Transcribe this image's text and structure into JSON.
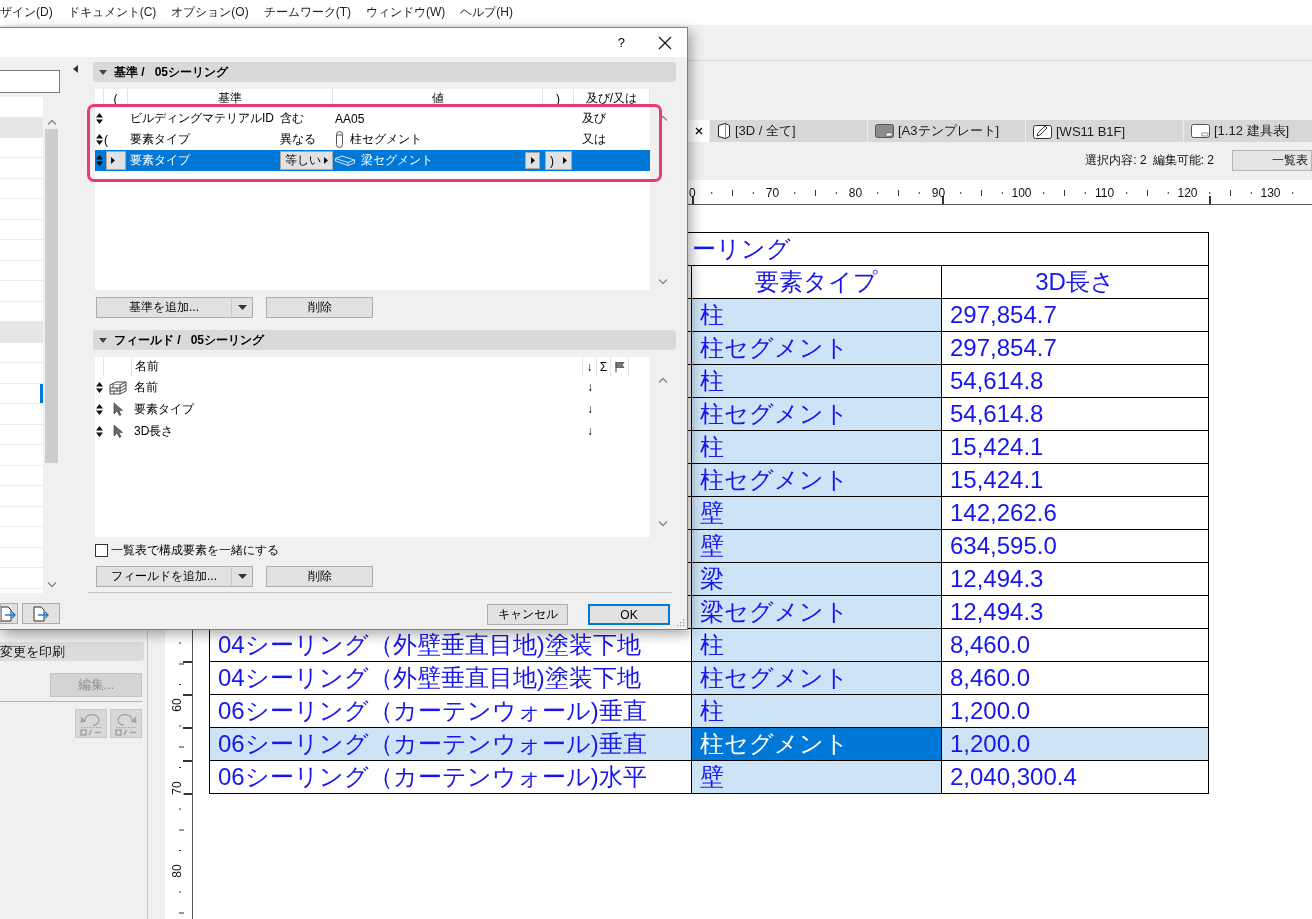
{
  "menu_bar": {
    "items": [
      "ザイン(D)",
      "ドキュメント(C)",
      "オプション(O)",
      "チームワーク(T)",
      "ウィンドウ(W)",
      "ヘルプ(H)"
    ]
  },
  "tab_bar": {
    "tabs": [
      {
        "selected": true
      },
      {
        "kind": "model",
        "label": "[3D / 全て]",
        "selected": false
      },
      {
        "kind": "master",
        "label": "[A3テンプレート]",
        "selected": false
      },
      {
        "kind": "worksheet",
        "label": "[WS11 B1F]",
        "selected": false
      },
      {
        "kind": "layout",
        "label": "[1.12 建具表]",
        "selected": false
      }
    ]
  },
  "info_bar": {
    "selection": "選択内容: 2",
    "editable": "編集可能: 2",
    "schedule_button": "一覧表"
  },
  "left_panel": {
    "section": "変更を印刷",
    "edit_button": {
      "label": "編集...",
      "disabled": true
    },
    "undo": {
      "disabled": true
    },
    "redo": {
      "disabled": true
    }
  },
  "horizontal_ruler": {
    "labels": [
      "0",
      "70",
      "80",
      "90",
      "100",
      "110",
      "120",
      "130"
    ]
  },
  "vertical_ruler": {
    "labels": [
      "60",
      "70",
      "80"
    ]
  },
  "schedule": {
    "title": "ーリング",
    "columns": [
      {
        "highlighted": false
      },
      {
        "label": "要素タイプ",
        "highlighted": true
      },
      {
        "label": "3D長さ",
        "highlighted": false
      }
    ],
    "rows": [
      {
        "type": "柱",
        "length": "297,854.7",
        "selected": false,
        "type_focused": false
      },
      {
        "type": "柱セグメント",
        "length": "297,854.7",
        "selected": false,
        "type_focused": false
      },
      {
        "type": "柱",
        "length": "54,614.8",
        "selected": false,
        "type_focused": false
      },
      {
        "type": "柱セグメント",
        "length": "54,614.8",
        "selected": false,
        "type_focused": false
      },
      {
        "type": "柱",
        "length": "15,424.1",
        "selected": false,
        "type_focused": false
      },
      {
        "type": "柱セグメント",
        "length": "15,424.1",
        "selected": false,
        "type_focused": false
      },
      {
        "type": "壁",
        "length": "142,262.6",
        "selected": false,
        "type_focused": false
      },
      {
        "type": "壁",
        "length": "634,595.0",
        "selected": false,
        "type_focused": false
      },
      {
        "type": "梁",
        "length": "12,494.3",
        "selected": false,
        "type_focused": false
      },
      {
        "type": "梁セグメント",
        "length": "12,494.3",
        "selected": false,
        "type_focused": false
      },
      {
        "name": "04シーリング（外壁垂直目地)塗装下地",
        "type": "柱",
        "length": "8,460.0",
        "selected": false,
        "type_focused": false
      },
      {
        "name": "04シーリング（外壁垂直目地)塗装下地",
        "type": "柱セグメント",
        "length": "8,460.0",
        "selected": false,
        "type_focused": false
      },
      {
        "name": "06シーリング（カーテンウォール)垂直",
        "type": "柱",
        "length": "1,200.0",
        "selected": false,
        "type_focused": false
      },
      {
        "name": "06シーリング（カーテンウォール)垂直",
        "type": "柱セグメント",
        "length": "1,200.0",
        "selected": true,
        "type_focused": true
      },
      {
        "name": "06シーリング（カーテンウォール)水平",
        "type": "壁",
        "length": "2,040,300.4",
        "selected": false,
        "type_focused": false
      }
    ]
  },
  "dialog": {
    "help": "?",
    "scheme_list": {
      "rows": [
        {
          "kind": "group",
          "selected": false
        },
        {
          "kind": "item",
          "selected": false
        },
        {
          "kind": "item",
          "selected": false
        },
        {
          "kind": "item",
          "selected": false
        },
        {
          "kind": "item",
          "selected": false
        },
        {
          "kind": "item",
          "selected": false
        },
        {
          "kind": "item",
          "selected": false
        },
        {
          "kind": "item",
          "selected": false
        },
        {
          "kind": "item",
          "selected": false
        },
        {
          "kind": "item",
          "selected": false
        },
        {
          "kind": "group",
          "selected": false
        },
        {
          "kind": "item",
          "selected": false
        },
        {
          "kind": "item",
          "selected": false
        },
        {
          "kind": "item",
          "selected": true
        },
        {
          "kind": "item",
          "selected": false
        },
        {
          "kind": "item",
          "selected": false
        },
        {
          "kind": "item",
          "selected": false
        },
        {
          "kind": "item",
          "selected": false
        },
        {
          "kind": "item",
          "selected": false
        },
        {
          "kind": "item",
          "selected": false
        },
        {
          "kind": "item",
          "selected": false
        },
        {
          "kind": "item",
          "selected": false
        },
        {
          "kind": "item",
          "selected": false
        }
      ]
    },
    "criteria": {
      "expanded": true,
      "label": "基準 /",
      "scheme": "05シーリング",
      "highlighted": true,
      "headers": [
        "(",
        "基準",
        "値",
        ")",
        "及び/又は"
      ],
      "rows": [
        {
          "kind": "plain",
          "criterion": "ビルディングマテリアルID",
          "operator": "含む",
          "value": "AA05",
          "conjunction": "及び",
          "selected": false
        },
        {
          "kind": "column",
          "open_paren": "(",
          "criterion": "要素タイプ",
          "operator": "異なる",
          "value": "柱セグメント",
          "conjunction": "又は",
          "selected": false
        },
        {
          "kind": "beam",
          "criterion": "要素タイプ",
          "operator": "等しい",
          "value": "梁セグメント",
          "close_paren": ")",
          "selected": true
        }
      ],
      "add_button": "基準を追加...",
      "delete_button": "削除"
    },
    "fields": {
      "expanded": true,
      "label": "フィールド /",
      "scheme": "05シーリング",
      "headers": [
        "名前",
        "↓",
        "Σ"
      ],
      "rows": [
        {
          "kind": "block",
          "name": "名前",
          "sort": "↓"
        },
        {
          "kind": "pointer",
          "name": "要素タイプ",
          "sort": "↓"
        },
        {
          "kind": "pointer",
          "name": "3D長さ",
          "sort": "↓"
        }
      ],
      "add_button": "フィールドを追加...",
      "delete_button": "削除"
    },
    "merge_components": {
      "label": "一覧表で構成要素を一緒にする",
      "checked": false
    },
    "buttons": [
      {
        "label": "キャンセル",
        "default": false
      },
      {
        "label": "OK",
        "default": true
      }
    ]
  }
}
